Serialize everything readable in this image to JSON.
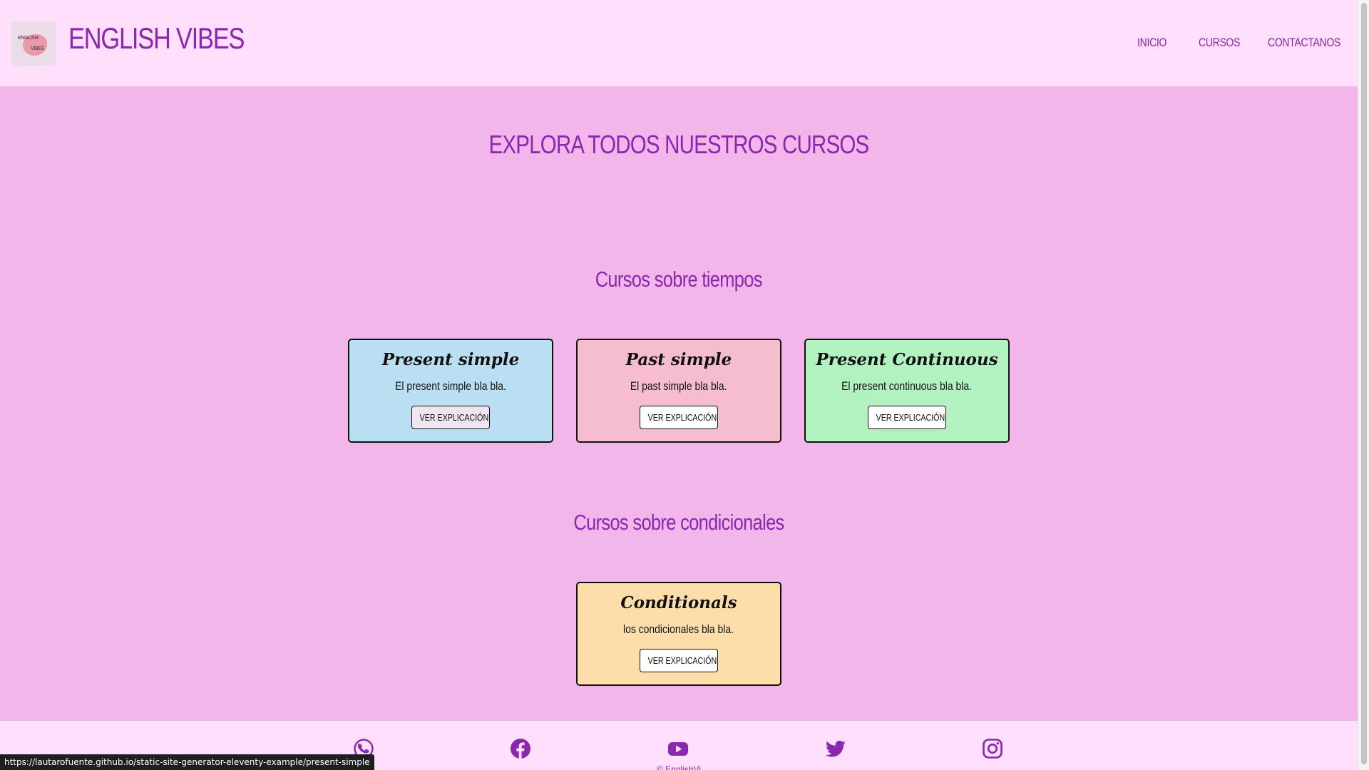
{
  "header": {
    "logo_text_line1": "ENGLISH",
    "logo_text_line2": "VIBES",
    "site_title": "ENGLISH VIBES",
    "nav": [
      "INICIO",
      "CURSOS",
      "CONTACTANOS"
    ]
  },
  "main": {
    "heading": "EXPLORA TODOS NUESTROS CURSOS",
    "sections": [
      {
        "title": "Cursos sobre tiempos",
        "courses": [
          {
            "title": "Present simple",
            "description": "El present simple bla bla.",
            "button": "VER EXPLICACIÓN",
            "color": "#badff2"
          },
          {
            "title": "Past simple",
            "description": "El past simple bla bla.",
            "button": "VER EXPLICACIÓN",
            "color": "#f5bdcd"
          },
          {
            "title": "Present Continuous",
            "description": "El present continuous bla bla.",
            "button": "VER EXPLICACIÓN",
            "color": "#b2f2c1"
          }
        ]
      },
      {
        "title": "Cursos sobre condicionales",
        "courses": [
          {
            "title": "Conditionals",
            "description": "los condicionales bla bla.",
            "button": "VER EXPLICACIÓN",
            "color": "#fddeab"
          }
        ]
      }
    ]
  },
  "footer": {
    "social_icons": [
      "whatsapp-icon",
      "facebook-icon",
      "youtube-icon",
      "twitter-icon",
      "instagram-icon"
    ],
    "copyright": "© EnglishVi"
  },
  "status_bar": {
    "url": "https://lautarofuente.github.io/static-site-generator-eleventy-example/present-simple"
  },
  "colors": {
    "accent": "#8a26b0",
    "header_bg": "#ffdffb",
    "page_bg": "#f2b6ea"
  }
}
